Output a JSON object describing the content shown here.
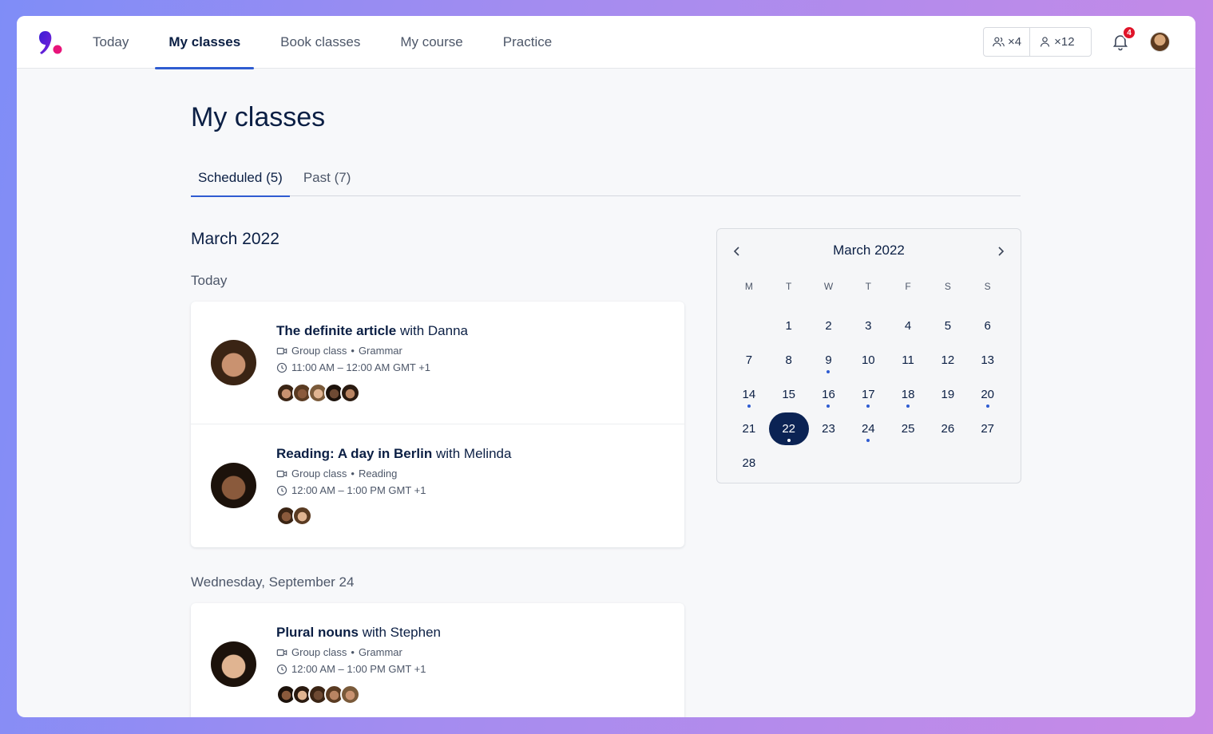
{
  "nav": {
    "links": [
      "Today",
      "My classes",
      "Book classes",
      "My course",
      "Practice"
    ],
    "active_index": 1,
    "group_credits": "×4",
    "private_credits": "×12",
    "notification_count": "4"
  },
  "page": {
    "title": "My classes",
    "tabs": [
      {
        "label": "Scheduled (5)",
        "active": true
      },
      {
        "label": "Past (7)",
        "active": false
      }
    ],
    "month_heading": "March 2022"
  },
  "groups": [
    {
      "label": "Today",
      "classes": [
        {
          "title": "The definite article",
          "with": "with Danna",
          "type": "Group class",
          "topic": "Grammar",
          "time": "11:00 AM – 12:00 AM GMT +1",
          "attendee_count": 5
        },
        {
          "title": "Reading: A day in Berlin",
          "with": "with Melinda",
          "type": "Group class",
          "topic": "Reading",
          "time": "12:00 AM – 1:00 PM GMT +1",
          "attendee_count": 2
        }
      ]
    },
    {
      "label": "Wednesday, September 24",
      "classes": [
        {
          "title": "Plural nouns",
          "with": "with Stephen",
          "type": "Group class",
          "topic": "Grammar",
          "time": "12:00 AM – 1:00 PM GMT +1",
          "attendee_count": 5
        }
      ]
    }
  ],
  "calendar": {
    "title": "March 2022",
    "weekdays": [
      "M",
      "T",
      "W",
      "T",
      "F",
      "S",
      "S"
    ],
    "first_weekday_offset": 1,
    "days_in_month": 28,
    "selected_day": 22,
    "days_with_classes": [
      9,
      14,
      16,
      17,
      18,
      20,
      22,
      24
    ]
  },
  "colors": {
    "accent": "#2f5cd1",
    "selected_day": "#0b2354",
    "badge": "#e0152a"
  }
}
